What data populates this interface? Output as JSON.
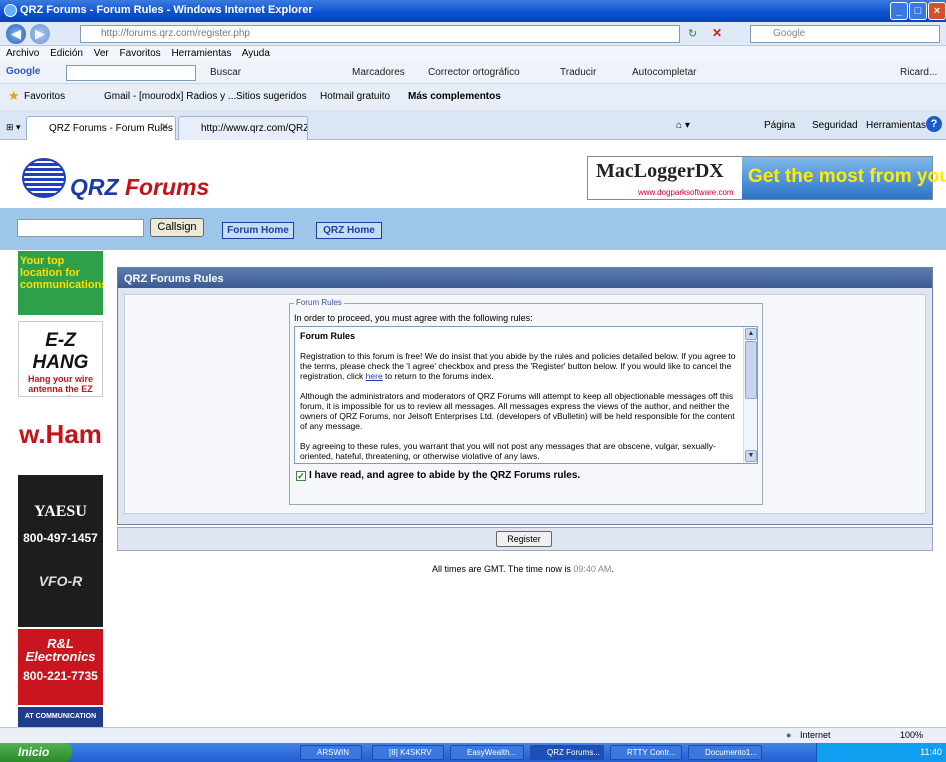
{
  "window": {
    "title": "QRZ Forums - Forum Rules - Windows Internet Explorer"
  },
  "browser": {
    "address": "http://forums.qrz.com/register.php",
    "search_placeholder": "Google",
    "menu": [
      "Archivo",
      "Edición",
      "Ver",
      "Favoritos",
      "Herramientas",
      "Ayuda"
    ],
    "google_toolbar": {
      "logo": "Google",
      "items": [
        "Buscar",
        "Marcadores",
        "Corrector ortográfico",
        "Traducir",
        "Autocompletar"
      ],
      "user": "Ricard..."
    },
    "favorites": {
      "label": "Favoritos",
      "items": [
        "Gmail - [mourodx] Radios y ...",
        "Sitios sugeridos",
        "Hotmail gratuito",
        "Más complementos"
      ]
    },
    "tabs": [
      "QRZ Forums - Forum Rules",
      "http://www.qrz.com/QRZ_T..."
    ],
    "tools": [
      "Página",
      "Seguridad",
      "Herramientas"
    ]
  },
  "site": {
    "logo_prefix": "QRZ",
    "logo_suffix": "Forums",
    "callsign_button": "Callsign",
    "nav": [
      "Forum Home",
      "QRZ Home"
    ],
    "ad_top": {
      "brand": "MacLoggerDX",
      "domain": "www.dogparksoftware.com",
      "tagline": "Get the most from your rig !"
    },
    "left_ads": {
      "ad1": "Your top location for communications.",
      "ad2_title": "E-Z HANG",
      "ad2_text": "Hang your wire antenna the EZ way!",
      "ad3": "w.Ham",
      "ad4_brand": "YAESU",
      "ad4_phone": "800-497-1457",
      "ad4_model": "VFO-R",
      "ad5_title": "R&L Electronics",
      "ad5_phone": "800-221-7735",
      "ad6": "AT COMMUNICATION"
    }
  },
  "rules": {
    "heading": "QRZ Forums Rules",
    "legend": "Forum Rules",
    "intro": "In order to proceed, you must agree with the following rules:",
    "box_title": "Forum Rules",
    "p1_a": "Registration to this forum is free! We do insist that you abide by the rules and policies detailed below. If you agree to the terms, please check the 'I agree' checkbox and press the 'Register' button below. If you would like to cancel the registration, click ",
    "p1_link": "here",
    "p1_b": " to return to the forums index.",
    "p2": "Although the administrators and moderators of QRZ Forums will attempt to keep all objectionable messages off this forum, it is impossible for us to review all messages. All messages express the views of the author, and neither the owners of QRZ Forums, nor Jelsoft Enterprises Ltd. (developers of vBulletin) will be held responsible for the content of any message.",
    "p3": "By agreeing to these rules, you warrant that you will not post any messages that are obscene, vulgar, sexually-oriented, hateful, threatening, or otherwise violative of any laws.",
    "agree_label": "I have read, and agree to abide by the QRZ Forums rules.",
    "agree_checked": true,
    "register_button": "Register"
  },
  "footer": {
    "time_prefix": "All times are GMT. The time now is ",
    "time": "09:40 AM",
    "time_suffix": "."
  },
  "status": {
    "zone": "Internet",
    "zoom": "100%"
  },
  "taskbar": {
    "start": "Inicio",
    "tasks": [
      "ARSWIN",
      "[8] K4SKRV",
      "EasyWealth...",
      "QRZ Forums...",
      "RTTY Contr...",
      "Documento1..."
    ],
    "clock": "11:40"
  }
}
